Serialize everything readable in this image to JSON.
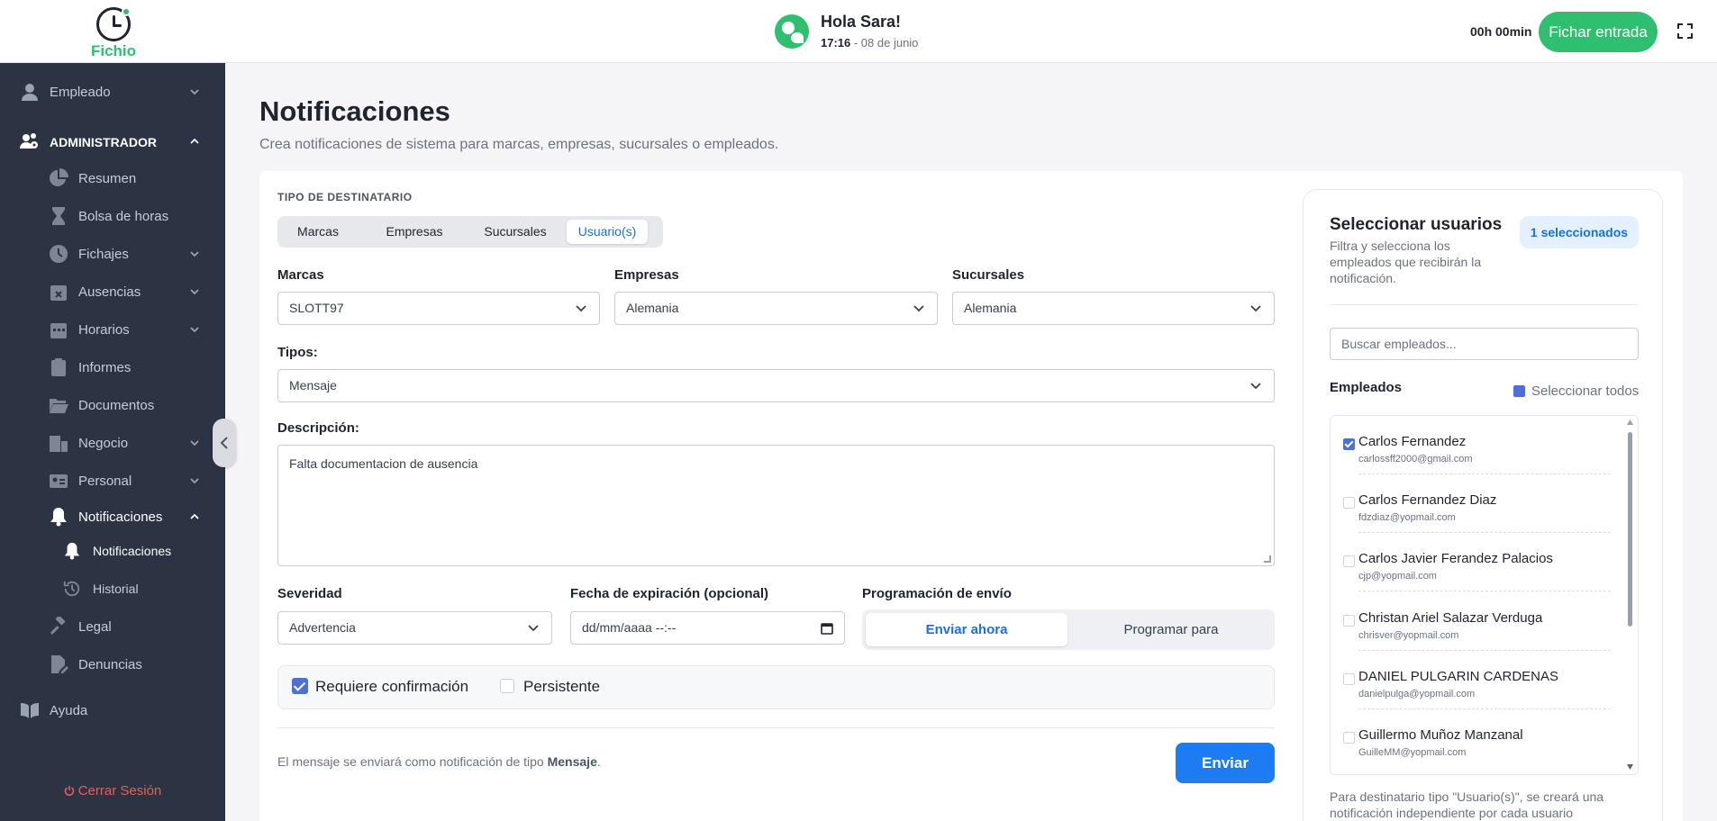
{
  "header": {
    "logo_text": "Fichio",
    "greeting": "Hola Sara!",
    "time": "17:16",
    "date_suffix": " - 08 de junio",
    "timer": "00h 00min",
    "clock_in_button": "Fichar entrada"
  },
  "sidebar": {
    "employee": "Empleado",
    "admin": "ADMINISTRADOR",
    "items": {
      "resumen": "Resumen",
      "bolsa": "Bolsa de horas",
      "fichajes": "Fichajes",
      "ausencias": "Ausencias",
      "horarios": "Horarios",
      "informes": "Informes",
      "documentos": "Documentos",
      "negocio": "Negocio",
      "personal": "Personal",
      "notificaciones": "Notificaciones",
      "notificaciones_sub": "Notificaciones",
      "historial": "Historial",
      "legal": "Legal",
      "denuncias": "Denuncias",
      "ayuda": "Ayuda"
    },
    "logout": "Cerrar Sesión"
  },
  "main": {
    "title": "Notificaciones",
    "subtitle": "Crea notificaciones de sistema para marcas, empresas, sucursales o empleados.",
    "recipient_type_label": "TIPO DE DESTINATARIO",
    "recipient_tabs": [
      "Marcas",
      "Empresas",
      "Sucursales",
      "Usuario(s)"
    ],
    "fields": {
      "marcas_label": "Marcas",
      "marcas_value": "SLOTT97",
      "empresas_label": "Empresas",
      "empresas_value": "Alemania",
      "sucursales_label": "Sucursales",
      "sucursales_value": "Alemania",
      "tipos_label": "Tipos:",
      "tipos_value": "Mensaje",
      "descripcion_label": "Descripción:",
      "descripcion_value": "Falta documentacion de ausencia",
      "severidad_label": "Severidad",
      "severidad_value": "Advertencia",
      "fecha_label": "Fecha de expiración (opcional)",
      "fecha_placeholder": "dd/mm/aaaa --:--",
      "programacion_label": "Programación de envío",
      "enviar_ahora": "Enviar ahora",
      "programar_para": "Programar para"
    },
    "options": {
      "requiere": "Requiere confirmación",
      "persistente": "Persistente"
    },
    "footer_prefix": "El mensaje se enviará como notificación de tipo ",
    "footer_type": "Mensaje",
    "footer_suffix": ".",
    "send_button": "Enviar"
  },
  "users_panel": {
    "title": "Seleccionar usuarios",
    "description": "Filtra y selecciona los empleados que recibirán la notificación.",
    "badge": "1 seleccionados",
    "search_placeholder": "Buscar empleados...",
    "employees_label": "Empleados",
    "select_all": "Seleccionar todos",
    "employees": [
      {
        "name": "Carlos Fernandez",
        "email": "carlossff2000@gmail.com",
        "checked": true
      },
      {
        "name": "Carlos Fernandez Diaz",
        "email": "fdzdiaz@yopmail.com",
        "checked": false
      },
      {
        "name": "Carlos Javier Ferandez Palacios",
        "email": "cjp@yopmail.com",
        "checked": false
      },
      {
        "name": "Christan Ariel Salazar Verduga",
        "email": "chrisver@yopmail.com",
        "checked": false
      },
      {
        "name": "DANIEL PULGARIN CARDENAS",
        "email": "danielpulga@yopmail.com",
        "checked": false
      },
      {
        "name": "Guillermo Muñoz Manzanal",
        "email": "GuilleMM@yopmail.com",
        "checked": false
      }
    ],
    "footnote": "Para destinatario tipo \"Usuario(s)\", se creará una notificación independiente por cada usuario"
  },
  "colors": {
    "sidebar_bg": "#2c3444",
    "accent_green": "#2fbf71",
    "accent_blue": "#1d7cf2",
    "logout_red": "#e85c5c"
  }
}
